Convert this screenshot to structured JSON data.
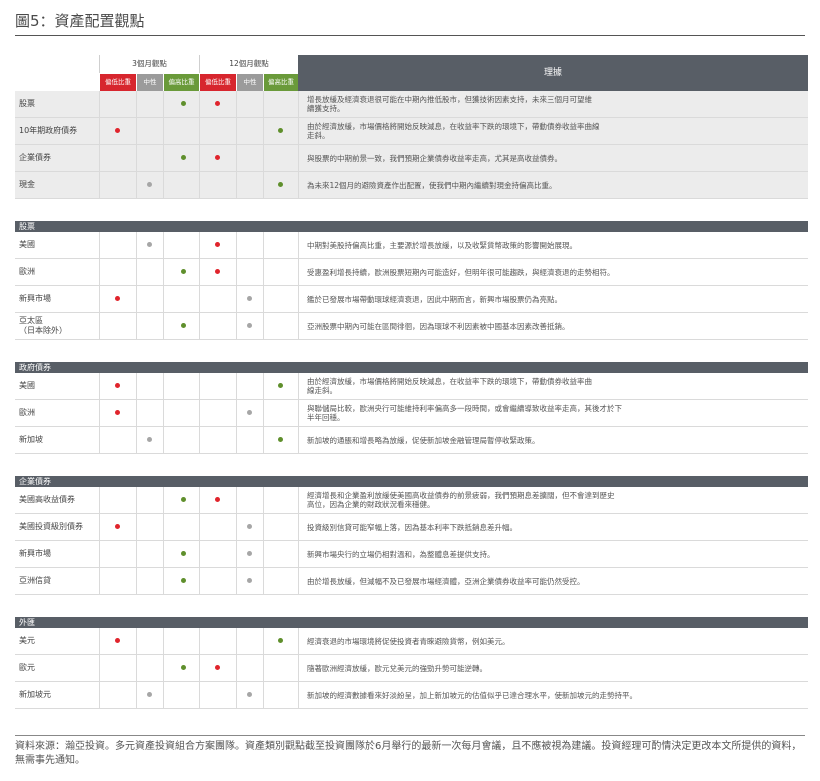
{
  "title": "圖5：資產配置觀點",
  "header": {
    "group1": "3個月觀點",
    "group2": "12個月觀點",
    "underweight": "偏低比重",
    "neutral": "中性",
    "overweight": "偏高比重",
    "reason": "理據"
  },
  "overview": [
    {
      "label": "股票",
      "d3": "neutral",
      "d12": "under",
      "text": "增長放緩及經濟衰退很可能在中期內推低股市，但獲技術因素支持，未來三個月可望維\n續獲支持。"
    },
    {
      "label": "10年期政府債券",
      "d3": "under",
      "d12": "over",
      "text": "由於經濟放緩，市場價格將開始反映減息，在收益率下跌的環境下，帶動債券收益率曲線\n走斜。"
    },
    {
      "label": "企業債券",
      "d3": "neutral",
      "d12": "under",
      "text": "與股票的中期前景一致，我們預期企業債券收益率走高，尤其是高收益債券。"
    },
    {
      "label": "現金",
      "d3": "mid",
      "d12": "over",
      "text": "為未來12個月的避險資產作出配置，使我們中期內繼續對現金持偏高比重。"
    }
  ],
  "sections": [
    {
      "name": "股票",
      "rows": [
        {
          "label": "美國",
          "d3": "mid",
          "d12": "under",
          "text": "中期對美股持偏高比重，主要源於增長放緩，以及收緊貨幣政策的影響開始展現。"
        },
        {
          "label": "歐洲",
          "d3": "neutral",
          "d12": "under",
          "text": "受惠盈利增長持續，歐洲股票短期內可能造好，但明年很可能趨跌，與經濟衰退的走勢相符。"
        },
        {
          "label": "新興市場",
          "d3": "under",
          "d12": "mid",
          "text": "鑑於已發展市場帶動環球經濟衰退，因此中期而言，新興市場股票仍為亮點。"
        },
        {
          "label": "亞太區\n（日本除外）",
          "d3": "neutral",
          "d12": "mid",
          "text": "亞洲股票中期內可能在區間徘徊，因為環球不利因素被中國基本因素改善抵銷。"
        }
      ]
    },
    {
      "name": "政府債券",
      "rows": [
        {
          "label": "美國",
          "d3": "under",
          "d12": "over",
          "text": "由於經濟放緩，市場價格將開始反映減息，在收益率下跌的環境下，帶動債券收益率曲\n線走斜。"
        },
        {
          "label": "歐洲",
          "d3": "under",
          "d12": "mid",
          "text": "與聯儲局比較，歐洲央行可能維持利率偏高多一段時間，或會繼續導致收益率走高，其後才於下\n半年回穩。"
        },
        {
          "label": "新加坡",
          "d3": "mid",
          "d12": "over",
          "text": "新加坡的通脹和增長略為放緩，促使新加坡金融管理局暫停收緊政策。"
        }
      ]
    },
    {
      "name": "企業債券",
      "rows": [
        {
          "label": "美國高收益債券",
          "d3": "neutral",
          "d12": "under",
          "text": "經濟增長和企業盈利放緩使美國高收益債券的前景疲弱，我們預期息差擴闊，但不會達到歷史\n高位，因為企業的財政狀況看來穩健。"
        },
        {
          "label": "美國投資級別債券",
          "d3": "under",
          "d12": "mid",
          "text": "投資級別信貸可能窄幅上落，因為基本利率下跌抵銷息差升幅。"
        },
        {
          "label": "新興市場",
          "d3": "neutral",
          "d12": "mid",
          "text": "新興市場央行的立場仍相對溫和，為整體息差提供支持。"
        },
        {
          "label": "亞洲信貸",
          "d3": "neutral",
          "d12": "mid",
          "text": "由於增長放緩，但減幅不及已發展市場經濟體，亞洲企業債券收益率可能仍然受控。"
        }
      ]
    },
    {
      "name": "外匯",
      "rows": [
        {
          "label": "美元",
          "d3": "under",
          "d12": "over",
          "text": "經濟衰退的市場環境將促使投資者青睞避險貨幣，例如美元。"
        },
        {
          "label": "歐元",
          "d3": "neutral",
          "d12": "under",
          "text": "隨著歐洲經濟放緩，歐元兌美元的強勁升勢可能逆轉。"
        },
        {
          "label": "新加坡元",
          "d3": "mid",
          "d12": "mid",
          "text": "新加坡的經濟數據看來好淡紛呈，加上新加坡元的估值似乎已達合理水平，使新加坡元的走勢持平。"
        }
      ]
    }
  ],
  "footnote": "資料來源：瀚亞投資。多元資產投資組合方案團隊。資產類別觀點截至投資團隊於6月舉行的最新一次每月會議，且不應被視為建議。投資經理可酌情決定更改本文所提供的資料，無需事先通知。",
  "colors": {
    "underweight": "#d7262e",
    "neutral": "#9b9b9b",
    "overweight": "#6a9a3a",
    "header": "#585e66"
  }
}
